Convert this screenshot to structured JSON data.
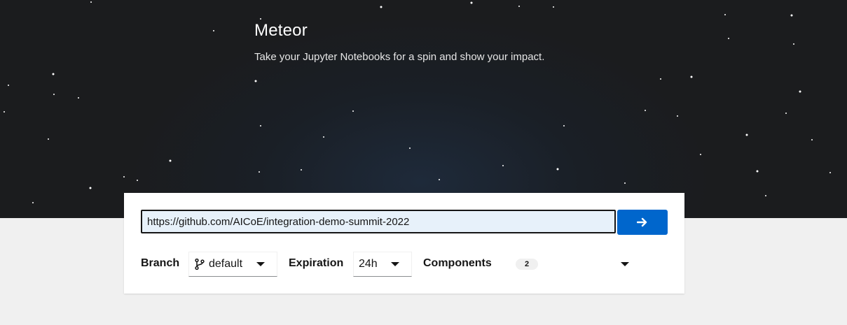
{
  "app": {
    "title": "Meteor",
    "tagline": "Take your Jupyter Notebooks for a spin and show your impact."
  },
  "form": {
    "repo_url": "https://github.com/AICoE/integration-demo-summit-2022",
    "submit_icon": "arrow-right-icon",
    "branch": {
      "label": "Branch",
      "icon": "code-branch-icon",
      "value": "default"
    },
    "expiration": {
      "label": "Expiration",
      "value": "24h"
    },
    "components": {
      "label": "Components",
      "count": "2"
    }
  },
  "colors": {
    "hero_background": "#1b1c1e",
    "primary_button": "#0066cc",
    "page_background": "#f0f0f0",
    "input_background": "#e7f1fa"
  }
}
